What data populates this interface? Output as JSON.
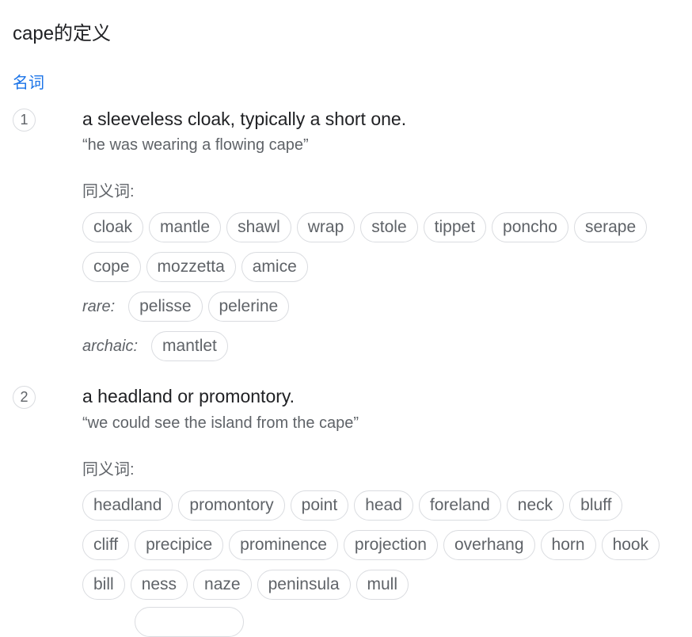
{
  "header": {
    "title": "cape的定义",
    "part_of_speech": "名词"
  },
  "synonyms_label": "同义词:",
  "senses": [
    {
      "number": "1",
      "definition": "a sleeveless cloak, typically a short one.",
      "example": "“he was wearing a flowing cape”",
      "synonym_rows": [
        [
          "cloak",
          "mantle",
          "shawl",
          "wrap",
          "stole",
          "tippet",
          "poncho",
          "serape"
        ],
        [
          "cope",
          "mozzetta",
          "amice"
        ]
      ],
      "rare_label": "rare:",
      "rare": [
        "pelisse",
        "pelerine"
      ],
      "archaic_label": "archaic:",
      "archaic": [
        "mantlet"
      ]
    },
    {
      "number": "2",
      "definition": "a headland or promontory.",
      "example": "“we could see the island from the cape”",
      "synonym_rows": [
        [
          "headland",
          "promontory",
          "point",
          "head",
          "foreland",
          "neck",
          "bluff"
        ],
        [
          "cliff",
          "precipice",
          "prominence",
          "projection",
          "overhang",
          "horn",
          "hook"
        ],
        [
          "bill",
          "ness",
          "naze",
          "peninsula",
          "mull"
        ]
      ]
    }
  ]
}
